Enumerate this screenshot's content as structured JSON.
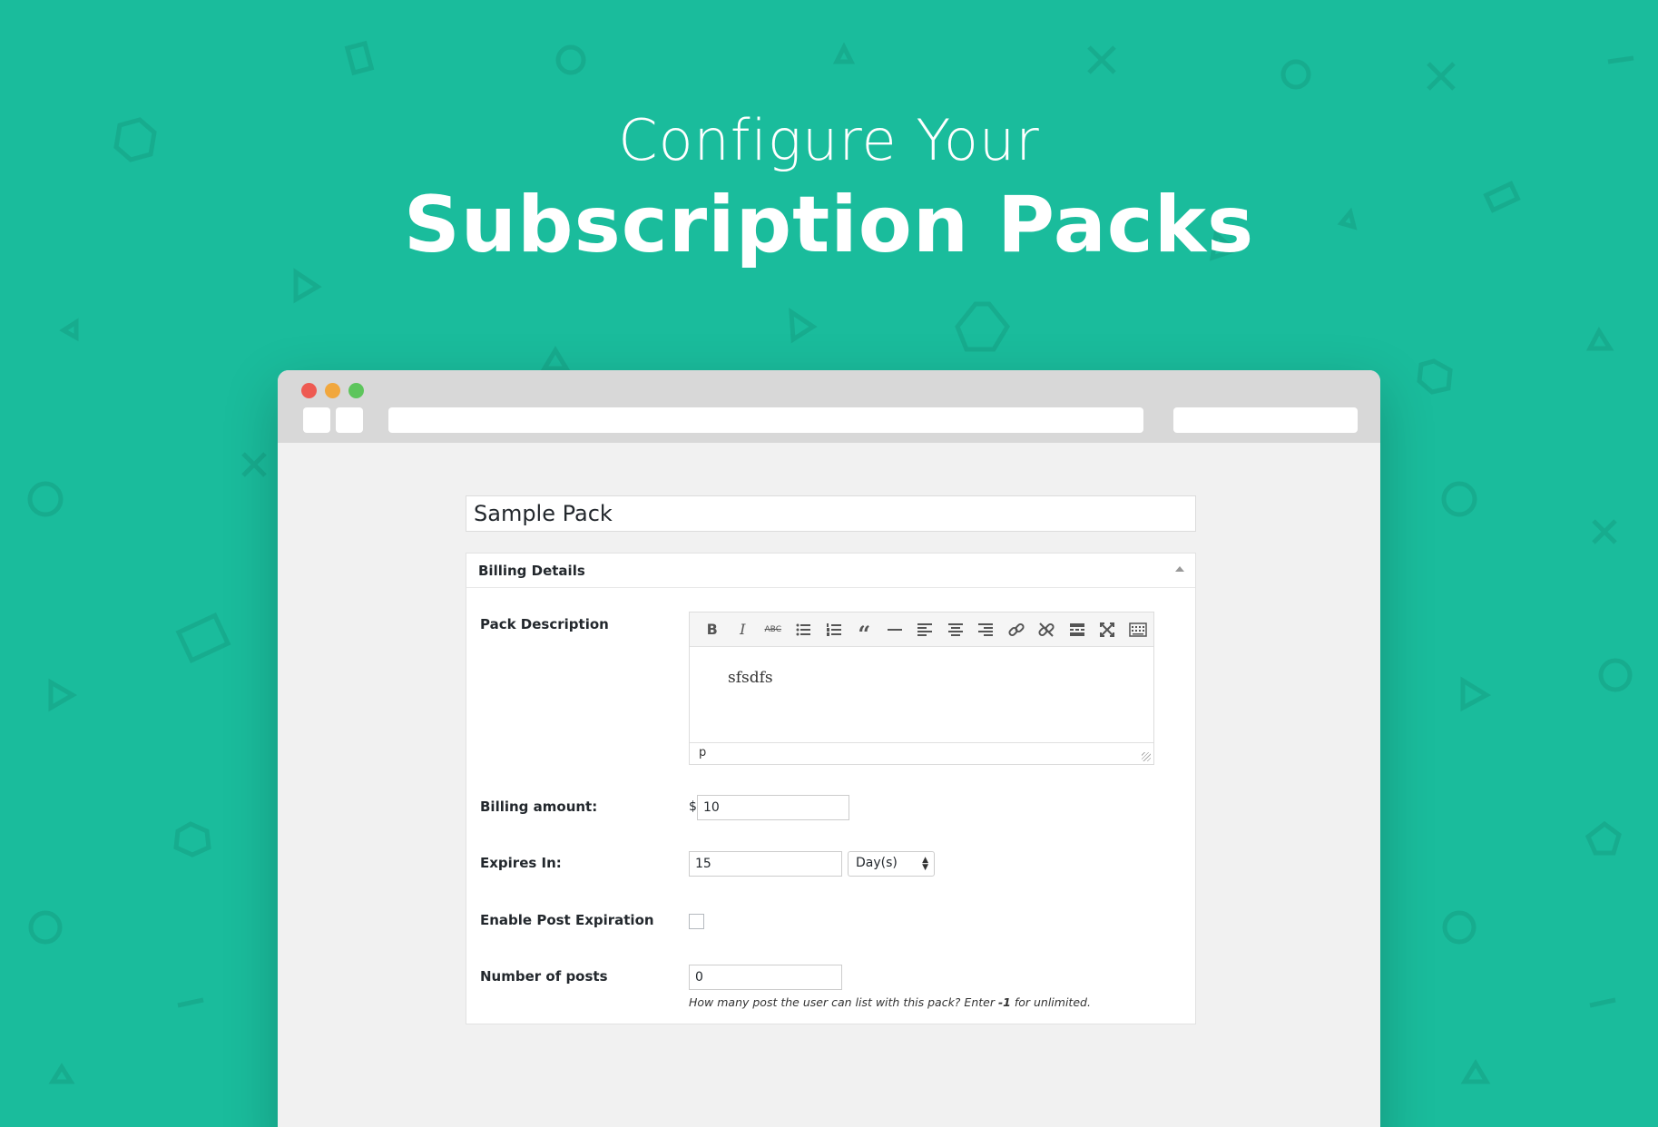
{
  "headline": {
    "line1": "Configure Your",
    "line2": "Subscription Packs"
  },
  "window": {
    "traffic_lights": [
      "#ee5a52",
      "#f1a73d",
      "#5dc55c"
    ]
  },
  "form": {
    "title_value": "Sample Pack",
    "section_title": "Billing Details",
    "fields": {
      "pack_description_label": "Pack Description",
      "editor_content": "sfsdfs",
      "editor_path": "p",
      "billing_amount_label": "Billing amount:",
      "currency_symbol": "$",
      "billing_amount_value": "10",
      "expires_in_label": "Expires In:",
      "expires_in_value": "15",
      "expires_unit": "Day(s)",
      "post_expiration_label": "Enable Post Expiration",
      "post_expiration_checked": false,
      "num_posts_label": "Number of posts",
      "num_posts_value": "0",
      "num_posts_hint_before": "How many post the user can list with this pack? Enter ",
      "num_posts_hint_bold": "-1",
      "num_posts_hint_after": " for unlimited."
    },
    "toolbar_buttons": [
      "bold-icon",
      "italic-icon",
      "strikethrough-icon",
      "bullet-list-icon",
      "numbered-list-icon",
      "blockquote-icon",
      "horizontal-rule-icon",
      "align-left-icon",
      "align-center-icon",
      "align-right-icon",
      "link-icon",
      "unlink-icon",
      "read-more-icon",
      "fullscreen-icon",
      "toolbar-toggle-icon"
    ]
  },
  "colors": {
    "background": "#1abc9c",
    "window_chrome": "#d8d8d8",
    "content_bg": "#f1f1f1"
  }
}
